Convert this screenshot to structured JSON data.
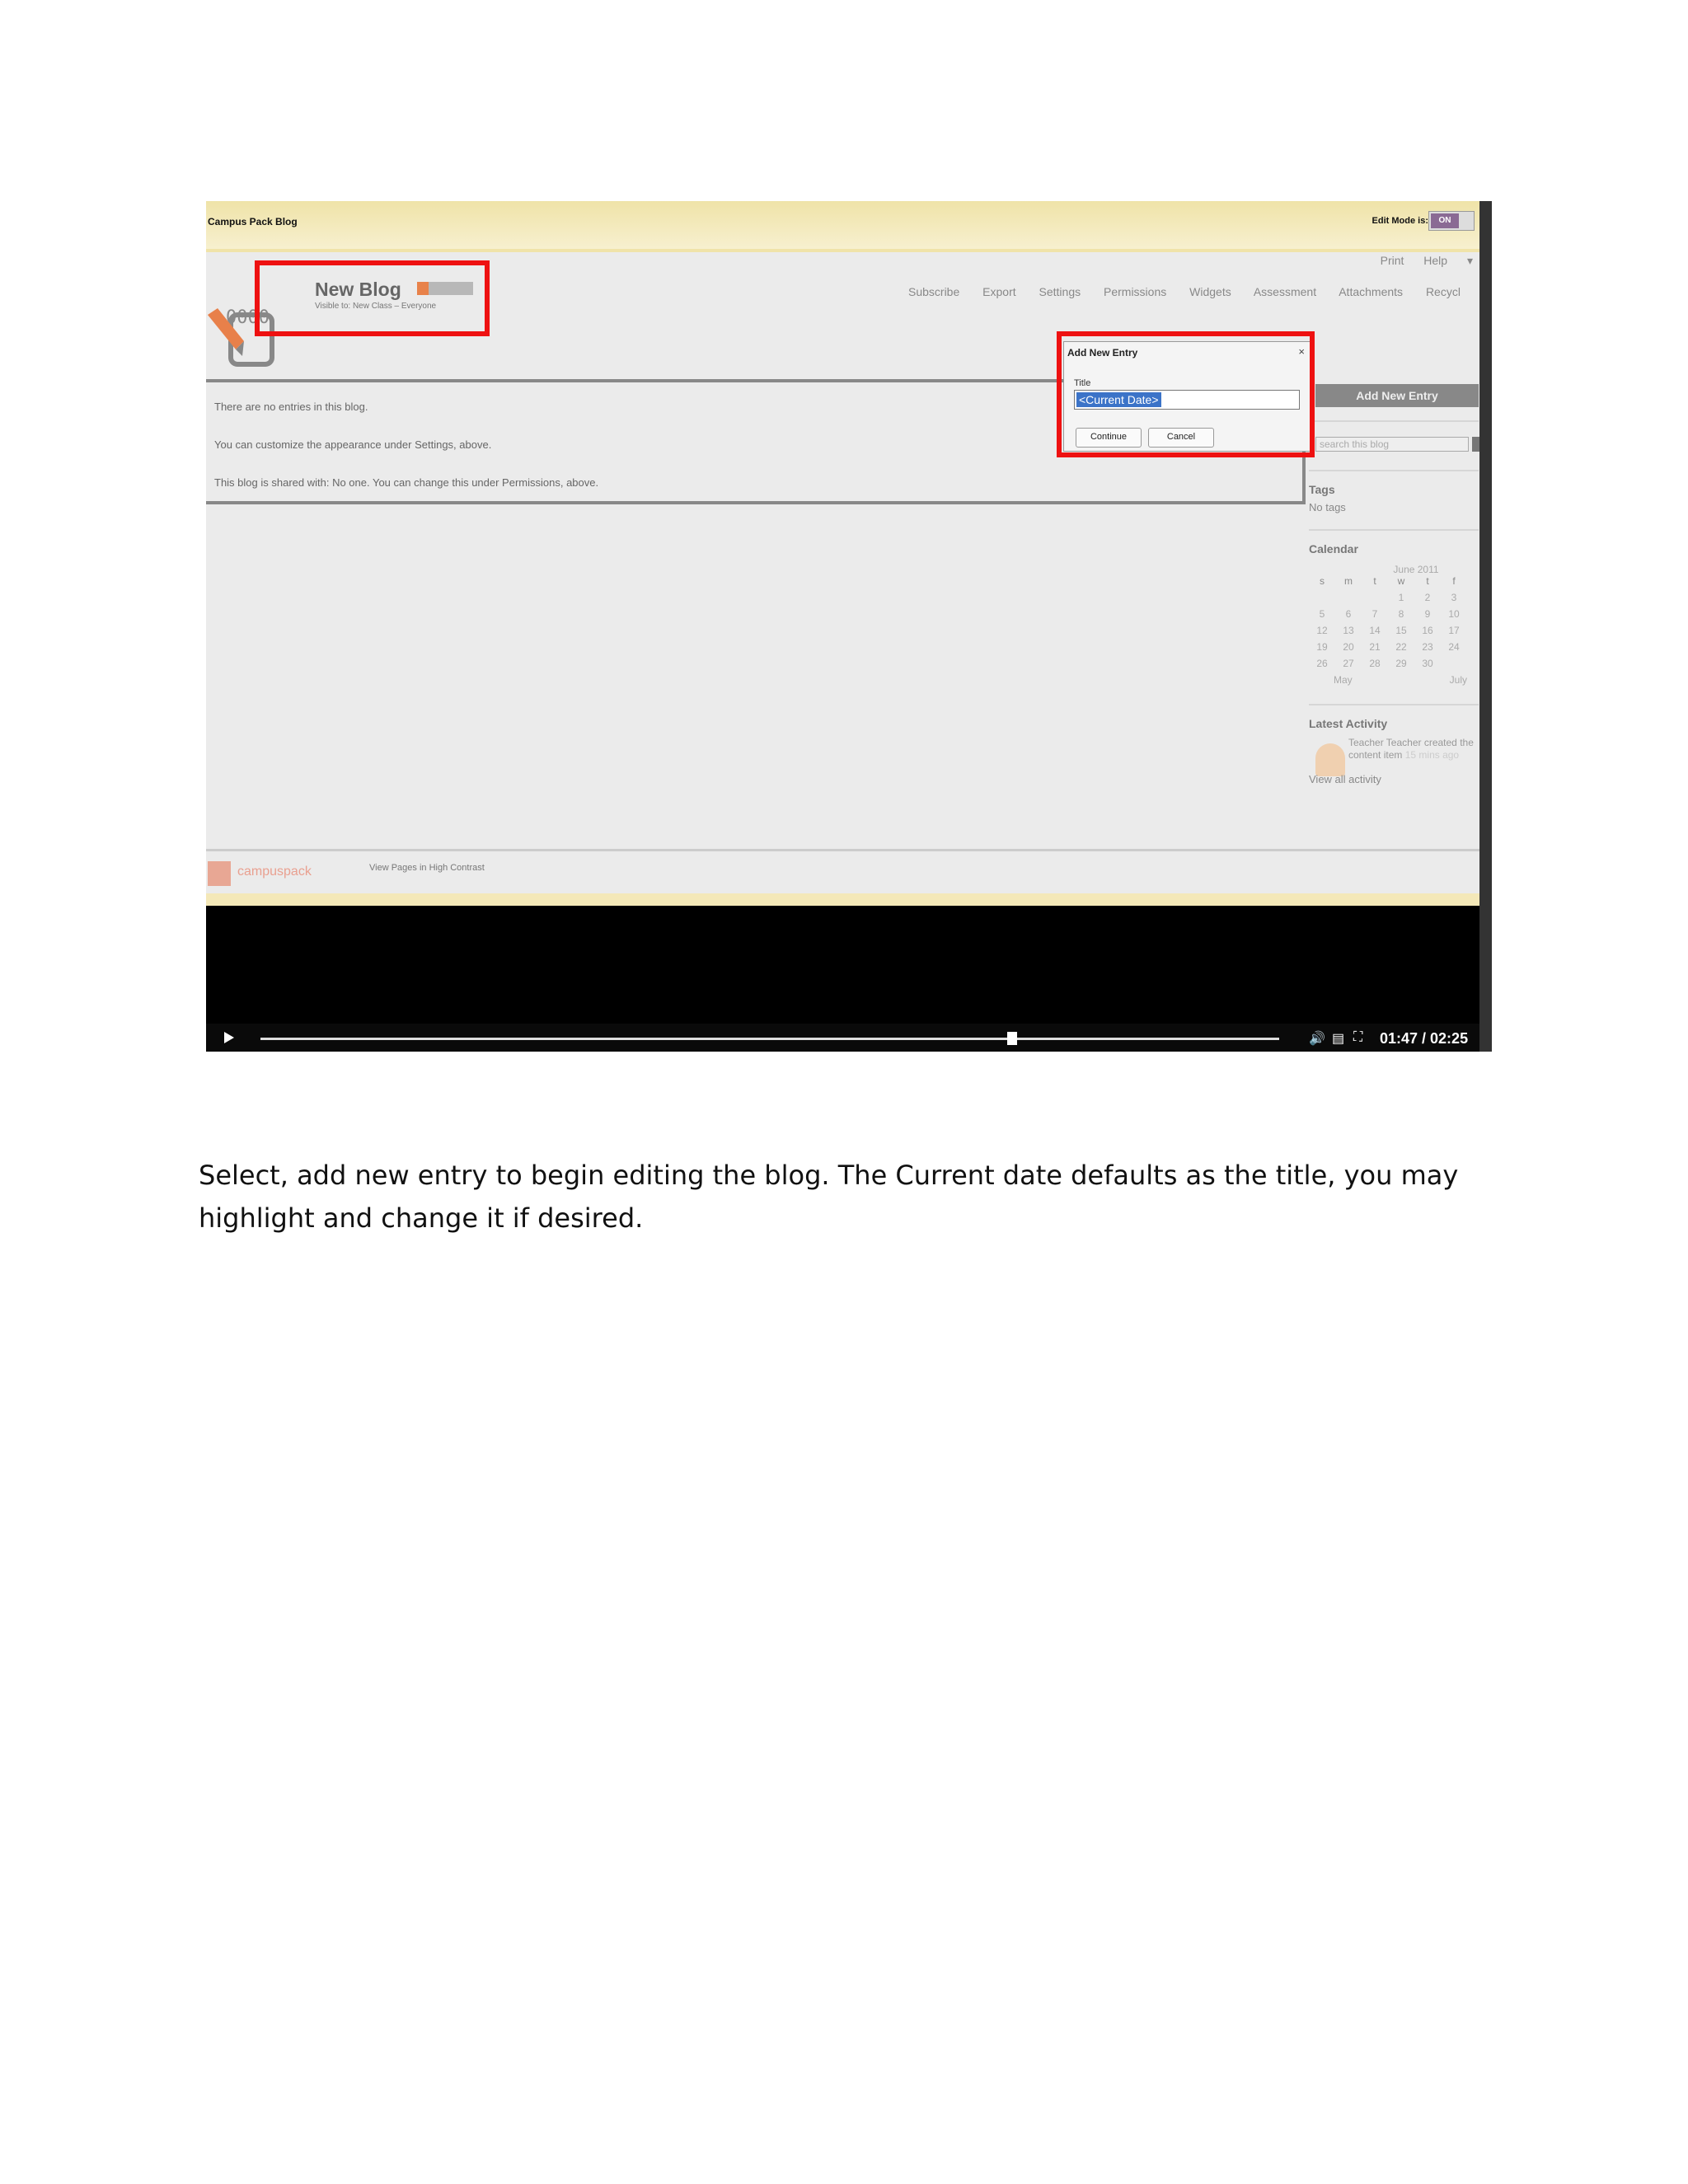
{
  "video": {
    "app": {
      "breadcrumb": "Campus Pack Blog",
      "edit_mode_label": "Edit Mode is:",
      "edit_mode_value": "ON",
      "print_help": "Print   Help ▾",
      "blog_title": "New Blog",
      "blog_subtitle": "Visible to: New Class – Everyone",
      "nav": [
        "Subscribe",
        "Export",
        "Settings",
        "Permissions",
        "Widgets",
        "Assessment",
        "Attachments",
        "Recycl"
      ],
      "content_lines": [
        "There are no entries in this blog.",
        "You can customize the appearance under Settings, above.",
        "This blog is shared with: No one. You can change this under Permissions, above."
      ],
      "add_entry_button": "Add New Entry",
      "search_placeholder": "search this blog",
      "tags_heading": "Tags",
      "tags_value": "No tags",
      "calendar_heading": "Calendar",
      "calendar": {
        "month": "June 2011",
        "weekdays": [
          "s",
          "m",
          "t",
          "w",
          "t",
          "f"
        ],
        "weeks": [
          [
            "",
            "",
            "",
            "1",
            "2",
            "3"
          ],
          [
            "5",
            "6",
            "7",
            "8",
            "9",
            "10"
          ],
          [
            "12",
            "13",
            "14",
            "15",
            "16",
            "17"
          ],
          [
            "19",
            "20",
            "21",
            "22",
            "23",
            "24"
          ],
          [
            "26",
            "27",
            "28",
            "29",
            "30",
            ""
          ]
        ],
        "prev": "May",
        "next": "July"
      },
      "activity_heading": "Latest Activity",
      "activity_text": "Teacher Teacher created the content item",
      "activity_time": "15 mins ago",
      "view_all": "View all activity",
      "footer_brand": "campuspack",
      "footer_link": "View Pages in High Contrast"
    },
    "dialog": {
      "title": "Add New Entry",
      "close": "×",
      "label": "Title",
      "value": "<Current Date>",
      "continue": "Continue",
      "cancel": "Cancel"
    },
    "player": {
      "progress": 0.738,
      "time": "01:47 / 02:25"
    }
  },
  "caption": "Select, add new entry to begin editing the blog. The Current date defaults as the title, you may highlight and change it if desired.",
  "colors": {
    "highlight": "#ee1111",
    "accent": "#8a6a94"
  }
}
